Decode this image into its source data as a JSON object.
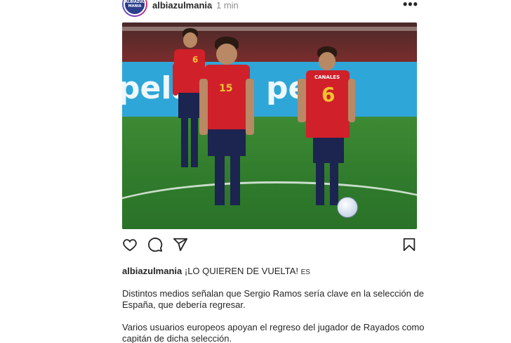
{
  "header": {
    "avatar_text": "ALBIAZUL MANIA",
    "username": "albiazulmania",
    "separator": "•",
    "time": "1 min",
    "more_label": "•••"
  },
  "photo": {
    "banner_text_left": "pela",
    "banner_text_right": "pela",
    "player_numbers": [
      "6",
      "15",
      "6"
    ],
    "player_name": "CANALES"
  },
  "caption": {
    "username": "albiazulmania",
    "headline": "¡LO QUIEREN DE VUELTA!",
    "flag": "ES",
    "paragraph1_line1": "Distintos medios señalan que Sergio Ramos sería clave en la selección de",
    "paragraph1_line2": "España, que debería regresar.",
    "paragraph2_line1": "Varios usuarios europeos apoyan el regreso del jugador de Rayados como",
    "paragraph2_line2": "capitán de dicha selección."
  },
  "colors": {
    "text": "#262626",
    "muted": "#8e8e8e",
    "jersey": "#d0202a",
    "banner": "#2fa6d8"
  },
  "icons": [
    "heart-icon",
    "comment-icon",
    "share-icon",
    "bookmark-icon",
    "more-options-icon"
  ]
}
